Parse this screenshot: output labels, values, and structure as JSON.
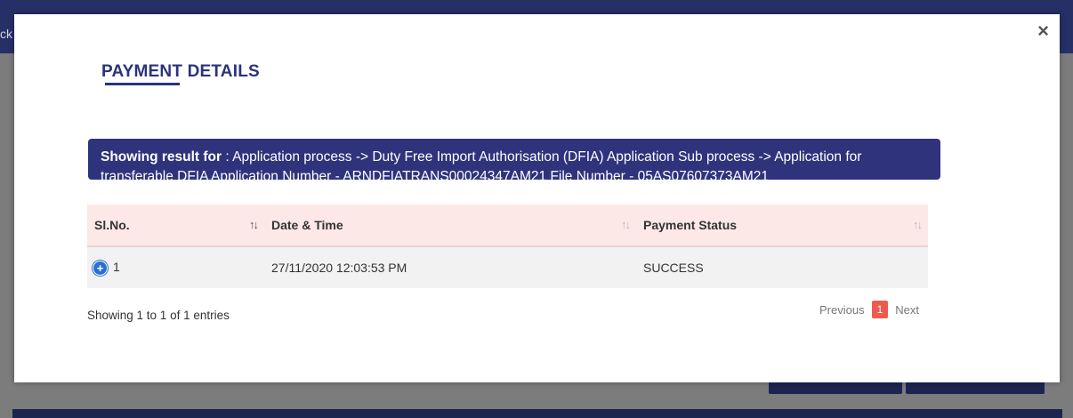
{
  "background": {
    "topbar_text": "ck"
  },
  "modal": {
    "close_label": "×",
    "title": "PAYMENT DETAILS",
    "banner": {
      "label": "Showing result for",
      "text": " : Application process -> Duty Free Import Authorisation (DFIA) Application Sub process -> Application for transferable DFIA Application Number - ARNDFIATRANS00024347AM21 File Number - 05AS07607373AM21"
    },
    "table": {
      "headers": [
        "Sl.No.",
        "Date & Time",
        "Payment Status"
      ],
      "rows": [
        {
          "sl_no": "1",
          "date_time": "27/11/2020 12:03:53 PM",
          "status": "SUCCESS"
        }
      ]
    },
    "info": "Showing 1 to 1 of 1 entries",
    "pager": {
      "previous": "Previous",
      "current": "1",
      "next": "Next"
    }
  },
  "colors": {
    "accent": "#2e337c",
    "header_bg": "#fde8e8",
    "pager_active": "#ee5a4e",
    "expand_icon": "#2a6fd6"
  }
}
